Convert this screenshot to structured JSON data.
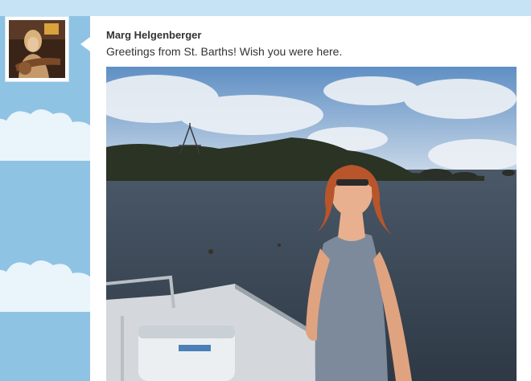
{
  "post": {
    "author_name": "Marg Helgenberger",
    "message": "Greetings from St. Barths! Wish you were here."
  },
  "colors": {
    "page_background": "#8fc3e4",
    "card_background": "#ffffff",
    "text": "#333333"
  }
}
